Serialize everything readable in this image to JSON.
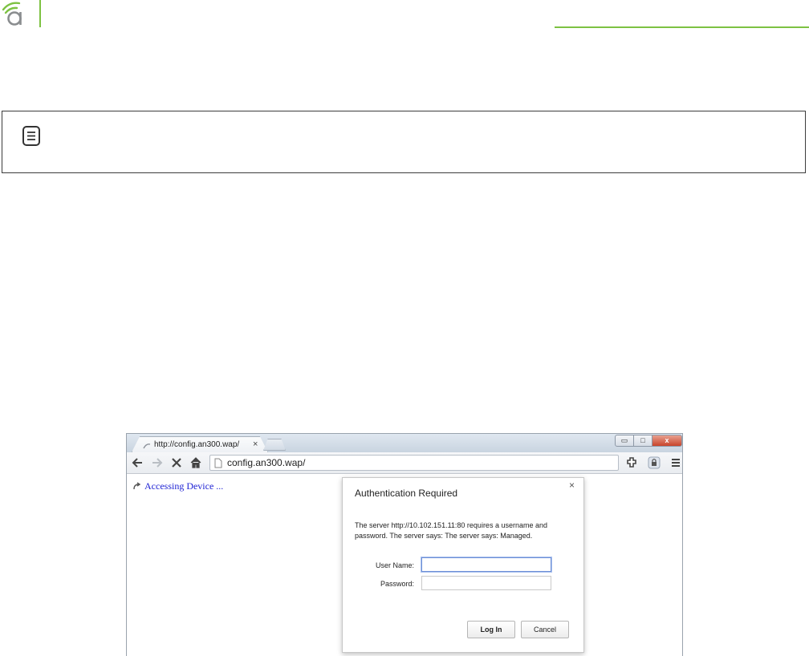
{
  "colors": {
    "brand_green": "#7dc242",
    "logo_gray": "#8a8d8f",
    "link_blue": "#1f23d4",
    "note_border": "#3c3c3c"
  },
  "icons": {
    "logo": "wifi-a-logo-icon",
    "note": "note-lines-icon"
  },
  "browser": {
    "tab": {
      "title": "http://config.an300.wap/",
      "close": "×"
    },
    "window_buttons": {
      "minimize": "▭",
      "maximize": "□",
      "close": "x"
    },
    "address_bar": {
      "url": "config.an300.wap/"
    },
    "page": {
      "status_text": "Accessing Device ..."
    }
  },
  "dialog": {
    "title": "Authentication Required",
    "close": "×",
    "message": "The server http://10.102.151.11:80 requires a username and password. The server says: The server says: Managed.",
    "username_label": "User Name:",
    "username_value": "",
    "password_label": "Password:",
    "password_value": "",
    "login_button": "Log In",
    "cancel_button": "Cancel"
  }
}
